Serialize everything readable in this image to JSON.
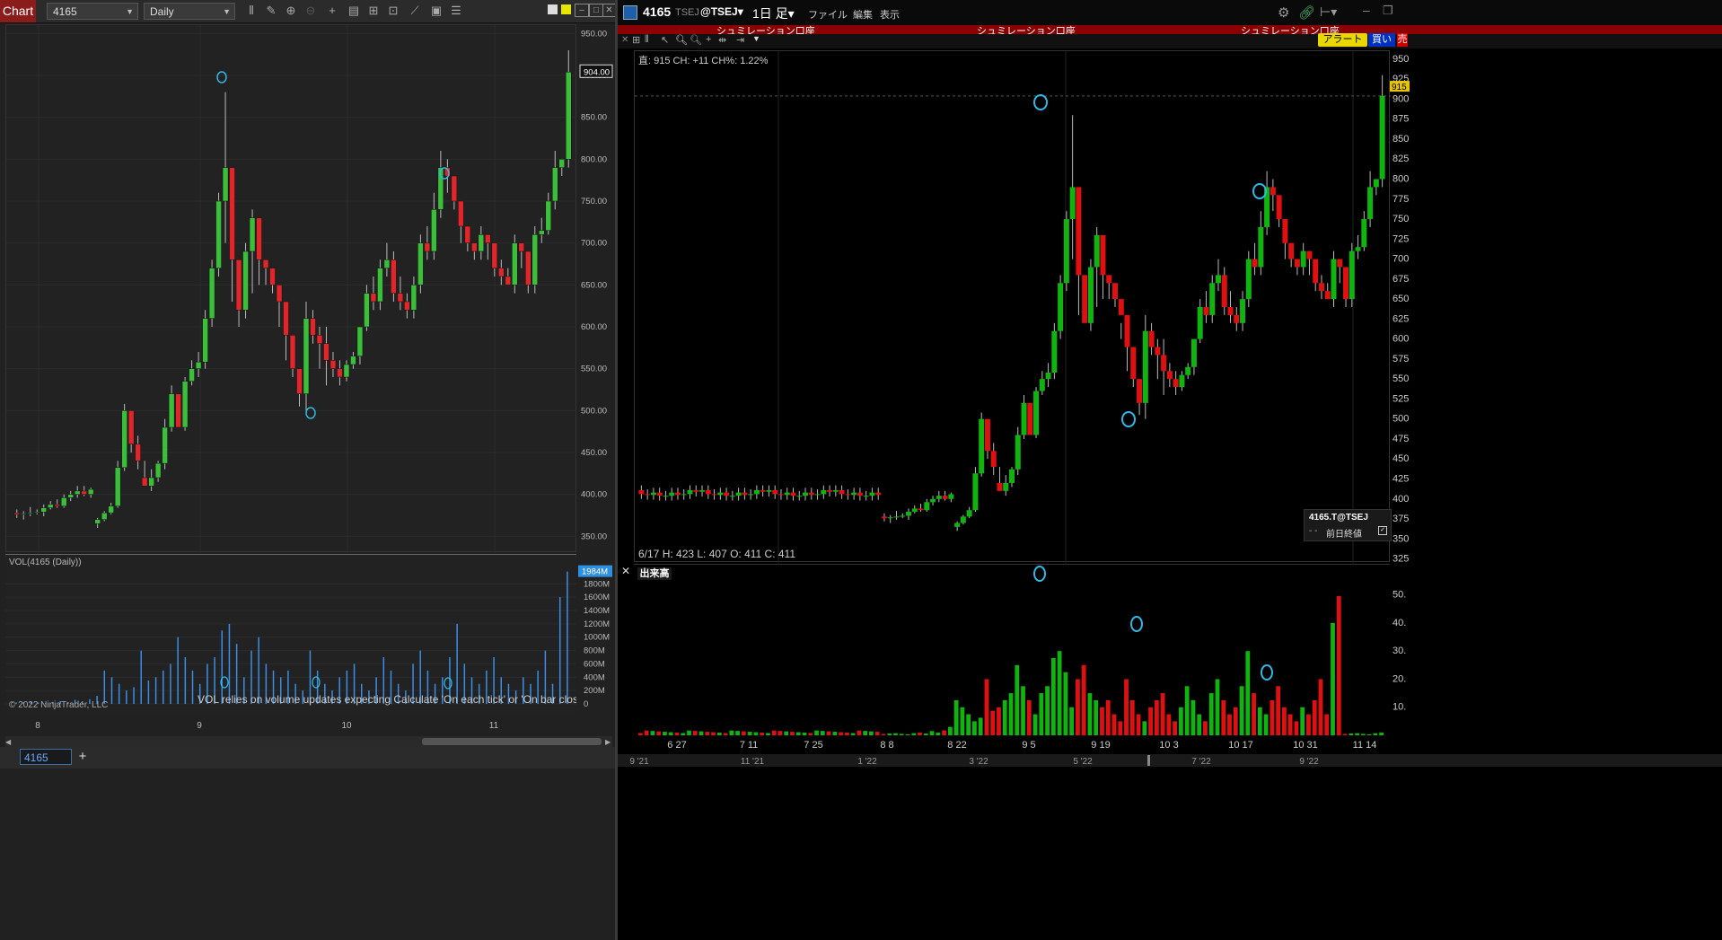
{
  "left": {
    "title": "Chart",
    "instrument": "4165",
    "interval": "Daily",
    "toolbar_icons": [
      "bar-type-icon",
      "draw-icon",
      "zoom-in-icon",
      "zoom-out-icon",
      "crosshair-icon",
      "data-box-icon",
      "properties-icon",
      "templates-icon",
      "strategies-icon",
      "indicators-icon",
      "drawing-objects-icon"
    ],
    "y_ticks": [
      "950.00",
      "900.00",
      "850.00",
      "800.00",
      "750.00",
      "700.00",
      "650.00",
      "600.00",
      "550.00",
      "500.00",
      "450.00",
      "400.00",
      "350.00"
    ],
    "last_price": "904.00",
    "vol_label": "VOL(4165 (Daily))",
    "vol_ticks": [
      "1800M",
      "1600M",
      "1400M",
      "1200M",
      "1000M",
      "800M",
      "600M",
      "400M",
      "200M",
      "0"
    ],
    "vol_last": "1984M",
    "vol_note": "VOL relies on volume updates expecting Calculate 'On each tick' or 'On bar close'",
    "copyright": "© 2022 NinjaTrader, LLC",
    "x_ticks": [
      "8",
      "9",
      "10",
      "11"
    ],
    "tab": "4165",
    "add_tab": "+"
  },
  "right": {
    "symbol": "4165",
    "exchange": "TSEJ",
    "exchange2": "@TSEJ▾",
    "period": "1日 足▾",
    "menu": [
      "ファイル",
      "編集",
      "表示"
    ],
    "account_banner": [
      "シュミレーション口座",
      "シュミレーション口座",
      "シュミレーション口座"
    ],
    "alert_button": "アラート",
    "buy_button": "買い",
    "sell_button": "売",
    "price_info": "直: 915 CH: +11 CH%: 1.22%",
    "ohlc_info": "6/17  H: 423   L: 407   O: 411   C: 411",
    "legend_symbol": "4165.T@TSEJ",
    "legend_prev": "前日終値",
    "vol_title": "出来高",
    "y_ticks": [
      "950",
      "925",
      "900",
      "875",
      "850",
      "825",
      "800",
      "775",
      "750",
      "725",
      "700",
      "675",
      "650",
      "625",
      "600",
      "575",
      "550",
      "525",
      "500",
      "475",
      "450",
      "425",
      "400",
      "375",
      "350",
      "325"
    ],
    "last_price": "915",
    "vol_ticks": [
      "50.",
      "40.",
      "30.",
      "20.",
      "10."
    ],
    "x_ticks": [
      "6 27",
      "7 11",
      "7 25",
      "8 8",
      "8 22",
      "9 5",
      "9 19",
      "10 3",
      "10 17",
      "10 31",
      "11 14"
    ],
    "overview_ticks": [
      "9 '21",
      "11 '21",
      "1 '22",
      "3 '22",
      "5 '22",
      "7 '22",
      "9 '22"
    ]
  },
  "chart_data": [
    {
      "type": "candlestick",
      "title": "4165 Daily",
      "ylim": [
        330,
        960
      ],
      "bars": [
        [
          378,
          382,
          372,
          376
        ],
        [
          376,
          380,
          370,
          377
        ],
        [
          377,
          385,
          374,
          378
        ],
        [
          378,
          382,
          376,
          379
        ],
        [
          379,
          388,
          374,
          384
        ],
        [
          384,
          392,
          382,
          388
        ],
        [
          388,
          394,
          384,
          386
        ],
        [
          386,
          400,
          384,
          396
        ],
        [
          396,
          404,
          392,
          400
        ],
        [
          400,
          410,
          396,
          404
        ],
        [
          404,
          410,
          398,
          400
        ],
        [
          400,
          408,
          396,
          406
        ],
        [
          365,
          372,
          360,
          370
        ],
        [
          370,
          380,
          368,
          378
        ],
        [
          378,
          390,
          376,
          386
        ],
        [
          386,
          440,
          384,
          432
        ],
        [
          432,
          508,
          428,
          500
        ],
        [
          500,
          470,
          450,
          460
        ],
        [
          460,
          470,
          430,
          440
        ],
        [
          420,
          440,
          410,
          410
        ],
        [
          410,
          430,
          404,
          420
        ],
        [
          420,
          440,
          415,
          437
        ],
        [
          437,
          490,
          430,
          480
        ],
        [
          480,
          530,
          475,
          520
        ],
        [
          520,
          520,
          480,
          480
        ],
        [
          480,
          540,
          476,
          535
        ],
        [
          535,
          560,
          530,
          550
        ],
        [
          550,
          570,
          540,
          558
        ],
        [
          558,
          620,
          550,
          610
        ],
        [
          610,
          680,
          600,
          670
        ],
        [
          670,
          760,
          660,
          750
        ],
        [
          750,
          880,
          700,
          790
        ],
        [
          790,
          700,
          630,
          680
        ],
        [
          680,
          600,
          600,
          620
        ],
        [
          620,
          700,
          610,
          690
        ],
        [
          690,
          740,
          640,
          730
        ],
        [
          730,
          700,
          650,
          680
        ],
        [
          680,
          680,
          650,
          670
        ],
        [
          670,
          660,
          640,
          650
        ],
        [
          650,
          620,
          600,
          630
        ],
        [
          630,
          620,
          560,
          590
        ],
        [
          590,
          580,
          540,
          550
        ],
        [
          550,
          520,
          505,
          520
        ],
        [
          520,
          630,
          500,
          610
        ],
        [
          610,
          620,
          580,
          590
        ],
        [
          590,
          600,
          550,
          580
        ],
        [
          580,
          600,
          530,
          560
        ],
        [
          560,
          570,
          540,
          550
        ],
        [
          550,
          560,
          530,
          540
        ],
        [
          540,
          560,
          535,
          555
        ],
        [
          555,
          570,
          550,
          565
        ],
        [
          565,
          600,
          555,
          600
        ],
        [
          600,
          650,
          595,
          640
        ],
        [
          640,
          660,
          620,
          630
        ],
        [
          630,
          680,
          620,
          670
        ],
        [
          670,
          700,
          660,
          680
        ],
        [
          680,
          690,
          630,
          640
        ],
        [
          640,
          660,
          620,
          630
        ],
        [
          630,
          640,
          610,
          620
        ],
        [
          620,
          660,
          610,
          650
        ],
        [
          650,
          710,
          640,
          700
        ],
        [
          700,
          720,
          680,
          690
        ],
        [
          690,
          760,
          680,
          740
        ],
        [
          740,
          810,
          730,
          790
        ],
        [
          790,
          800,
          760,
          780
        ],
        [
          780,
          770,
          740,
          750
        ],
        [
          750,
          740,
          700,
          720
        ],
        [
          720,
          720,
          690,
          700
        ],
        [
          700,
          700,
          680,
          690
        ],
        [
          690,
          720,
          680,
          710
        ],
        [
          710,
          710,
          680,
          700
        ],
        [
          700,
          690,
          660,
          670
        ],
        [
          670,
          680,
          650,
          660
        ],
        [
          660,
          670,
          650,
          650
        ],
        [
          650,
          710,
          640,
          700
        ],
        [
          700,
          690,
          670,
          690
        ],
        [
          690,
          660,
          640,
          650
        ],
        [
          650,
          720,
          640,
          710
        ],
        [
          710,
          730,
          700,
          715
        ],
        [
          715,
          760,
          710,
          750
        ],
        [
          750,
          810,
          740,
          790
        ],
        [
          790,
          800,
          780,
          800
        ],
        [
          800,
          930,
          790,
          904
        ]
      ],
      "volume_M": [
        20,
        25,
        30,
        20,
        15,
        30,
        40,
        25,
        60,
        40,
        70,
        120,
        500,
        400,
        300,
        200,
        250,
        800,
        350,
        400,
        500,
        600,
        1000,
        700,
        500,
        300,
        600,
        700,
        1100,
        1200,
        900,
        400,
        800,
        1000,
        600,
        500,
        400,
        500,
        300,
        200,
        800,
        500,
        300,
        200,
        400,
        500,
        600,
        300,
        200,
        400,
        700,
        500,
        300,
        200,
        600,
        800,
        500,
        300,
        400,
        700,
        1200,
        600,
        400,
        300,
        500,
        700,
        400,
        300,
        200,
        400,
        300,
        500,
        800,
        300,
        1600,
        1984
      ]
    },
    {
      "type": "candlestick",
      "title": "4165.T@TSEJ 1日 足",
      "ylim": [
        320,
        960
      ],
      "volume_ylim": [
        0,
        55
      ]
    }
  ]
}
